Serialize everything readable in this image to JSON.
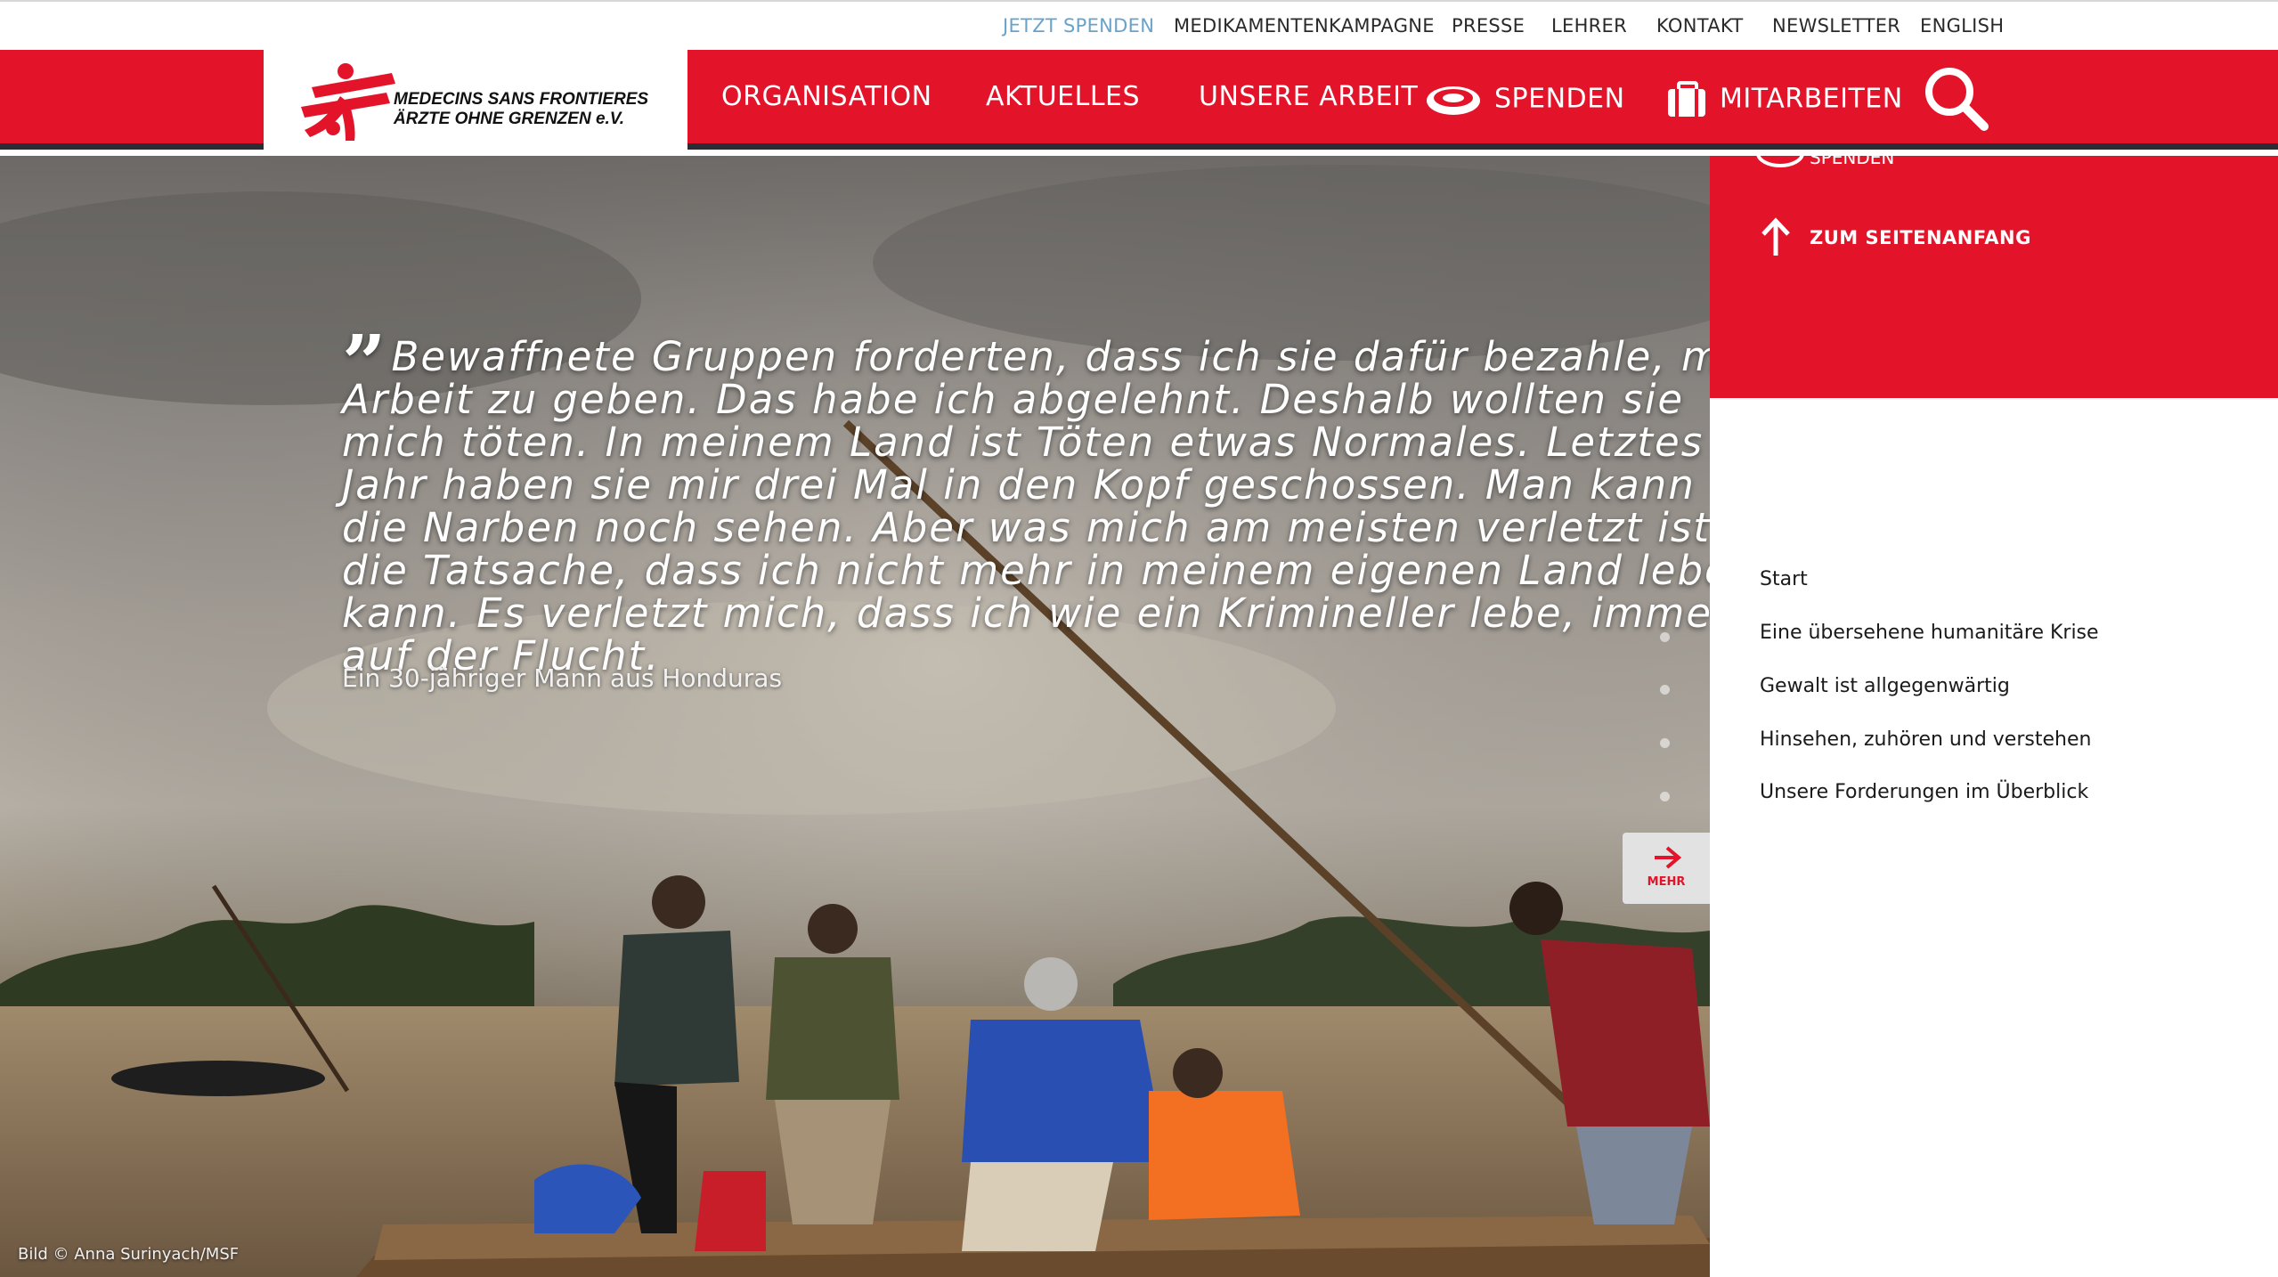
{
  "topbar": {
    "links": [
      {
        "label": "JETZT SPENDEN"
      },
      {
        "label": "MEDIKAMENTENKAMPAGNE"
      },
      {
        "label": "PRESSE"
      },
      {
        "label": "LEHRER"
      },
      {
        "label": "KONTAKT"
      },
      {
        "label": "NEWSLETTER"
      },
      {
        "label": "ENGLISH"
      }
    ]
  },
  "logo": {
    "line1": "MEDECINS SANS FRONTIERES",
    "line2": "ÄRZTE OHNE GRENZEN e.V."
  },
  "nav": {
    "items": [
      {
        "label": "ORGANISATION"
      },
      {
        "label": "AKTUELLES"
      },
      {
        "label": "UNSERE ARBEIT"
      },
      {
        "label": "SPENDEN",
        "icon": "coin-icon"
      },
      {
        "label": "MITARBEITEN",
        "icon": "suitcase-icon"
      }
    ],
    "search_icon": "search-icon"
  },
  "hero": {
    "quote": "Bewaffnete Gruppen forderten, dass ich sie dafür bezahle, mir Arbeit zu geben. Das habe ich abgelehnt. Deshalb wollten sie mich töten. In meinem Land ist Töten etwas Normales. Letztes Jahr haben sie mir drei Mal in den Kopf geschossen. Man kann die Narben noch sehen. Aber was mich am meisten verletzt ist die Tatsache, dass ich nicht mehr in meinem eigenen Land leben kann. Es verletzt mich, dass ich wie ein Krimineller lebe, immer auf der Flucht.",
    "author": "Ein 30-jähriger Mann aus Honduras",
    "credit": "Bild © Anna Surinyach/MSF",
    "more_label": "MEHR"
  },
  "side": {
    "partial_label": "SPENDEN",
    "to_top_label": "ZUM SEITENANFANG",
    "chapters": [
      {
        "label": "Start"
      },
      {
        "label": "Eine übersehene humanitäre Krise"
      },
      {
        "label": "Gewalt ist allgegenwärtig"
      },
      {
        "label": "Hinsehen, zuhören und verstehen"
      },
      {
        "label": "Unsere Forderungen im Überblick"
      }
    ]
  },
  "colors": {
    "brand_red": "#e3142a",
    "nav_underline": "#2c2c35",
    "donate_link": "#6aa3c9"
  }
}
